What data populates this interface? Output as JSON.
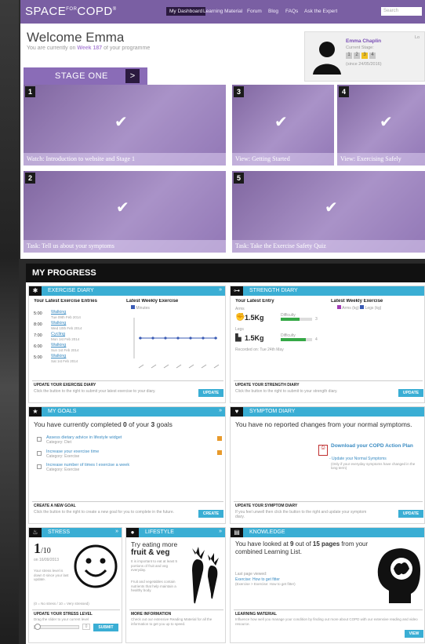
{
  "brand": {
    "logo": "SPACE",
    "logo_sup": "FOR",
    "logo_tail": "COPD",
    "logo_mark": "®"
  },
  "nav": [
    "My Dashboard",
    "Learning Material",
    "Forum",
    "Blog",
    "FAQs",
    "Ask the Expert"
  ],
  "search_placeholder": "Search",
  "welcome": {
    "title": "Welcome Emma",
    "sub_pre": "You are currently on ",
    "sub_week": "Week 187",
    "sub_post": " of your programme"
  },
  "user": {
    "name": "Emma Chaplin",
    "stage_label": "Current Stage:",
    "stages": [
      "1",
      "2",
      "3",
      "4"
    ],
    "since": "(since 24/05/2016)",
    "log": "Lo"
  },
  "stage": {
    "label": "STAGE ONE",
    "arrow": ">"
  },
  "tiles": [
    {
      "num": "1",
      "caption": "Watch: Introduction to website and Stage 1"
    },
    {
      "num": "3",
      "caption": "View: Getting Started"
    },
    {
      "num": "4",
      "caption": "View: Exercising Safely"
    },
    {
      "num": "2",
      "caption": "Task: Tell us about your symptoms"
    },
    {
      "num": "5",
      "caption": "Task: Take the Exercise Safety Quiz"
    }
  ],
  "check_glyph": "✔",
  "progress": {
    "title": "MY PROGRESS"
  },
  "exercise": {
    "title": "EXERCISE DIARY",
    "head_left": "Your Latest Exercise Entries",
    "head_right": "Latest Weekly Exercise",
    "legend": "Minutes",
    "entries": [
      {
        "mins": "5:00",
        "name": "Walking",
        "date": "Tue 09th Feb 2014"
      },
      {
        "mins": "8:00",
        "name": "Walking",
        "date": "Wed 10th Feb 2014"
      },
      {
        "mins": "7:00",
        "name": "Cycling",
        "date": "Mon 1st Feb 2014"
      },
      {
        "mins": "6:00",
        "name": "Walking",
        "date": "Sun 1st Feb 2014"
      },
      {
        "mins": "5:00",
        "name": "Walking",
        "date": "Sat 1st Feb 2014"
      }
    ],
    "footer_title": "UPDATE YOUR EXERCISE DIARY",
    "footer_text": "Click the button to the right to submit your latest exercise to your diary.",
    "button": "UPDATE"
  },
  "strength": {
    "title": "STRENGTH DIARY",
    "head_left": "Your Latest Entry",
    "head_right": "Latest Weekly Exercise",
    "legend": [
      "Arms (kg)",
      "Legs (kg)"
    ],
    "arms_label": "Arms",
    "arms_val": "1.5Kg",
    "legs_label": "Legs",
    "legs_val": "1.5Kg",
    "difficulty": "Difficulty",
    "arms_level": "3",
    "legs_level": "4",
    "recorded": "Recorded on: Tue 24th May",
    "footer_title": "UPDATE YOUR STRENGTH DIARY",
    "footer_text": "Click the button to the right to submit to your strength diary.",
    "button": "UPDATE"
  },
  "goals": {
    "title": "MY GOALS",
    "summary_pre": "You have currently completed ",
    "done": "0",
    "summary_mid": " of your ",
    "total": "3",
    "summary_post": " goals",
    "items": [
      {
        "label": "Assess dietary advice in lifestyle widget",
        "cat": "Category: Diet"
      },
      {
        "label": "Increase your exercise time",
        "cat": "Category: Exercise"
      },
      {
        "label": "Increase number of times I exercise a week",
        "cat": "Category: Exercise"
      }
    ],
    "footer_title": "CREATE A NEW GOAL",
    "footer_text": "Click the button to the right to create a new goal for you to complete in the future.",
    "button": "CREATE"
  },
  "symptom": {
    "title": "SYMPTOM DIARY",
    "text": "You have no reported changes from your normal symptoms.",
    "download": "Download your COPD Action Plan",
    "update_link": "- Update your Normal Symptoms",
    "update_note": "(Only if your everyday symptoms have changed in the long term)",
    "footer_title": "UPDATE YOUR SYMPTOM DIARY",
    "footer_text": "If you feel unwell then click the button to the right and update your symptom diary.",
    "button": "UPDATE"
  },
  "stress": {
    "title": "STRESS",
    "value": "1",
    "den": "/10",
    "date": "on 16/09/2013",
    "desc": "Your stress level is down 0 since your last update.",
    "scale": "(0 = No stress / 10 = Very stressed)",
    "footer_title": "UPDATE YOUR STRESS LEVEL",
    "footer_text": "Drag the slider to your current level",
    "slider_val": "0",
    "button": "SUBMIT"
  },
  "lifestyle": {
    "title": "LIFESTYLE",
    "try": "Try eating more",
    "big": "fruit & veg",
    "p1": "It is important to eat at least 5 portions of fruit and veg everyday.",
    "p2": "Fruit and vegetables contain nutrients that help maintain a healthy body.",
    "footer_title": "MORE INFORMATION",
    "footer_text": "Check out our extensive Reading Material for all the information to get you up to speed."
  },
  "knowledge": {
    "title": "KNOWLEDGE",
    "text_pre": "You have looked at ",
    "viewed": "9",
    "text_mid": " out of ",
    "pages": "15 pages",
    "text_post": " from your combined Learning List.",
    "last_label": "Last page viewed:",
    "last_link": "Exercise: How to get fitter",
    "last_sub": "(Exercise > Exercise: How to get fitter)",
    "footer_title": "LEARNING MATERIAL",
    "footer_text": "Influence how well you manage your condition by finding out more about COPD with our extensive reading and video resource.",
    "button": "VIEW"
  }
}
